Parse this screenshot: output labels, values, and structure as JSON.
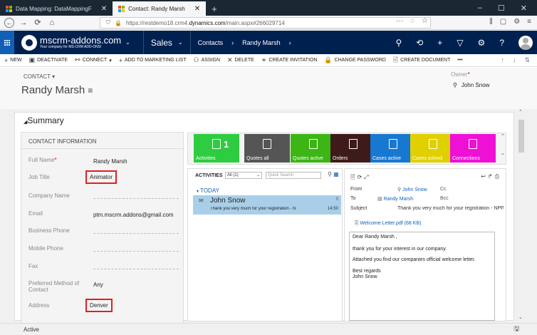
{
  "browser": {
    "tabs": [
      {
        "title": "Data Mapping: DataMappingF"
      },
      {
        "title": "Contact: Randy Marsh"
      }
    ],
    "url_prefix": "https://restdemo18.crm4.",
    "url_domain": "dynamics.com",
    "url_suffix": "/main.aspx#266029714"
  },
  "crm_nav": {
    "logo_main": "mscrm-addons.com",
    "logo_tagline": "Your company for MS-CRM ADD-ONS!",
    "app": "Sales",
    "breadcrumb": [
      "Contacts",
      "Randy Marsh"
    ]
  },
  "commands": [
    {
      "icon": "+",
      "label": "NEW",
      "name": "new-button"
    },
    {
      "icon": "▣",
      "label": "DEACTIVATE",
      "name": "deactivate-button"
    },
    {
      "icon": "⚯",
      "label": "CONNECT",
      "name": "connect-button"
    },
    {
      "icon": "+",
      "label": "ADD TO MARKETING LIST",
      "name": "add-to-marketing-list-button"
    },
    {
      "icon": "⚇",
      "label": "ASSIGN",
      "name": "assign-button"
    },
    {
      "icon": "✕",
      "label": "DELETE",
      "name": "delete-button"
    },
    {
      "icon": "⚭",
      "label": "CREATE INVITATION",
      "name": "create-invitation-button"
    },
    {
      "icon": "🔒",
      "label": "CHANGE PASSWORD",
      "name": "change-password-button"
    },
    {
      "icon": "🖹",
      "label": "CREATE DOCUMENT",
      "name": "create-document-button"
    }
  ],
  "header": {
    "entity": "CONTACT",
    "name": "Randy Marsh",
    "owner_label": "Owner",
    "owner": "John Snow"
  },
  "summary": "Summary",
  "contact_info": {
    "title": "CONTACT INFORMATION",
    "fields": [
      {
        "label": "Full Name",
        "value": "Randy Marsh"
      },
      {
        "label": "Job Title",
        "value": "Animator"
      },
      {
        "label": "Company Name",
        "value": ""
      },
      {
        "label": "Email",
        "value": "ptm.mscrm.addons@gmail.com"
      },
      {
        "label": "Business Phone",
        "value": ""
      },
      {
        "label": "Mobile Phone",
        "value": ""
      },
      {
        "label": "Fax",
        "value": ""
      },
      {
        "label": "Preferred Method of Contact",
        "value": "Any"
      },
      {
        "label": "Address",
        "value": "Denver"
      }
    ]
  },
  "tiles": [
    {
      "label": "Activities",
      "count": "1",
      "color": "#2ecc40"
    },
    {
      "label": "Quotes all",
      "color": "#555555"
    },
    {
      "label": "Quotes active",
      "color": "#3cb515"
    },
    {
      "label": "Orders",
      "color": "#3f1a1a"
    },
    {
      "label": "Cases active",
      "color": "#1778d1"
    },
    {
      "label": "Cases solved",
      "color": "#e0d000"
    },
    {
      "label": "Connections",
      "color": "#ee10d4"
    }
  ],
  "activities": {
    "title": "ACTIVITIES",
    "filter": "All (1)",
    "search_placeholder": "Quick Search",
    "group": "TODAY",
    "item": {
      "name": "John Snow",
      "subject": "Thank you very much for your registration - N",
      "count": "0",
      "time": "14:50"
    }
  },
  "mail": {
    "from_label": "From",
    "from": "John Snow",
    "cc_label": "Cc",
    "to_label": "To",
    "to": "Randy Marsh",
    "bcc_label": "Bcc",
    "subject_label": "Subject",
    "subject": "Thank you very much for your registration - NPFlow",
    "attachment": "Welcome Letter.pdf (68 KB)",
    "body": [
      "Dear    Randy Marsh ,",
      "thank you for your interest in our company.",
      "Attached you find our companies official welcome letter.",
      "Best regards",
      "John Snow"
    ]
  },
  "status": "Active"
}
